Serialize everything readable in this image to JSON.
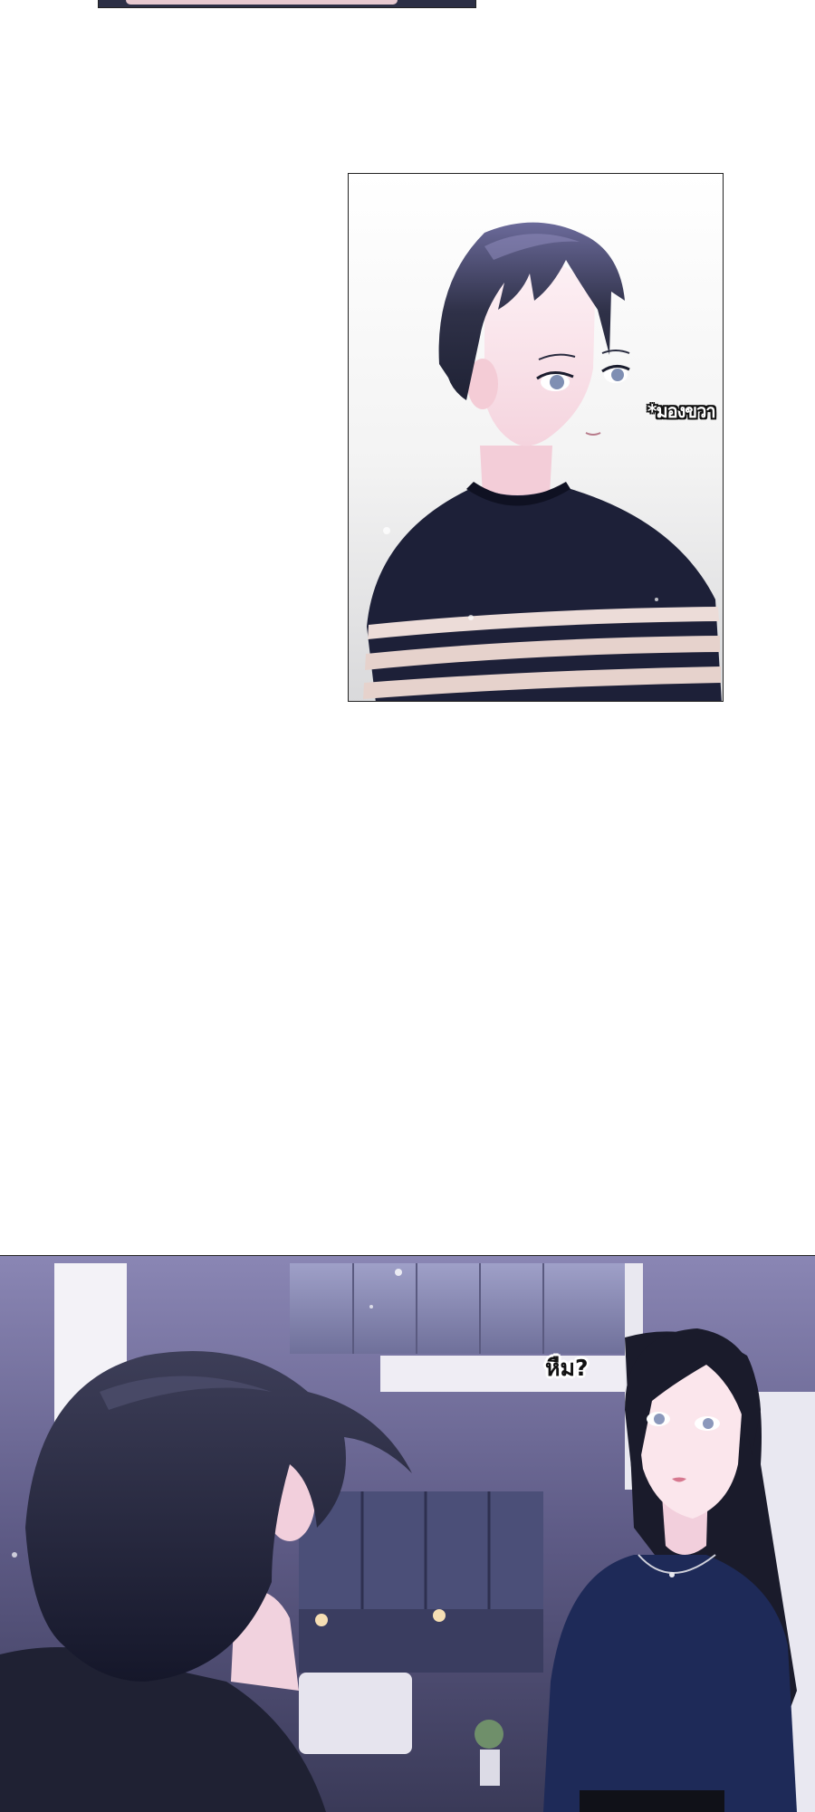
{
  "panels": {
    "top_fragment": {},
    "boy_closeup": {
      "sfx": "*มองขวา"
    },
    "room_scene": {
      "speech": "หืม?"
    }
  },
  "colors": {
    "outline": "#222222",
    "hair_dark": "#23263a",
    "sweater_navy": "#1d2038",
    "sweater_stripe": "#ecdcd8",
    "skin": "#fbe6ec",
    "room_purple": "#6e6a98",
    "woman_top": "#1e2a58"
  }
}
